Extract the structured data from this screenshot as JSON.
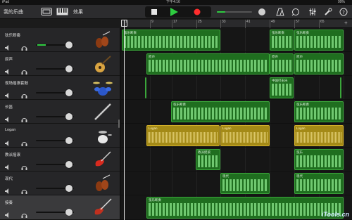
{
  "status": {
    "device": "iPad",
    "time": "下午4:16",
    "battery": "99%"
  },
  "toolbar": {
    "songs_label": "我的乐曲",
    "effects_label": "效果"
  },
  "ruler": {
    "marks": [
      "1",
      "9",
      "17",
      "25",
      "33",
      "41",
      "49",
      "57",
      "65"
    ]
  },
  "tracks": [
    {
      "name": "弦乐断奏",
      "instrument": "violin-icon",
      "volume": 0.88
    },
    {
      "name": "原声",
      "instrument": "acoustic-guitar-icon",
      "volume": 0.88
    },
    {
      "name": "现场摇滚套鼓",
      "instrument": "drumkit-icon",
      "volume": 0.88
    },
    {
      "name": "长笛",
      "instrument": "flute-icon",
      "volume": 0.88
    },
    {
      "name": "Logan",
      "instrument": "drum-machine-icon",
      "volume": 0.88
    },
    {
      "name": "教派摇滚",
      "instrument": "electric-guitar-icon",
      "volume": 0.88
    },
    {
      "name": "现代",
      "instrument": "violin-icon",
      "volume": 0.88
    },
    {
      "name": "接奏",
      "instrument": "bass-guitar-icon",
      "volume": 0.88
    }
  ],
  "regions": {
    "r0a": "弦乐断奏",
    "r0b": "弦乐断奏",
    "r0c": "弦乐断奏",
    "r1a": "原声",
    "r1b": "原声",
    "r1c": "原声",
    "r2a": "中国打击乐",
    "r3a": "弦乐断奏",
    "r3b": "弦乐断奏",
    "r4a": "Logan",
    "r4b": "Logan",
    "r4c": "Logan",
    "r5a": "教派摇滚",
    "r5b": "弦乐",
    "r6a": "现代",
    "r6b": "现代",
    "r7a": "弦乐断奏"
  },
  "watermark": "iTools.cn",
  "colors": {
    "region_green": "#1f6e1f",
    "region_yellow": "#a48a16",
    "play": "#2ecc40",
    "record": "#ff2d2d"
  }
}
